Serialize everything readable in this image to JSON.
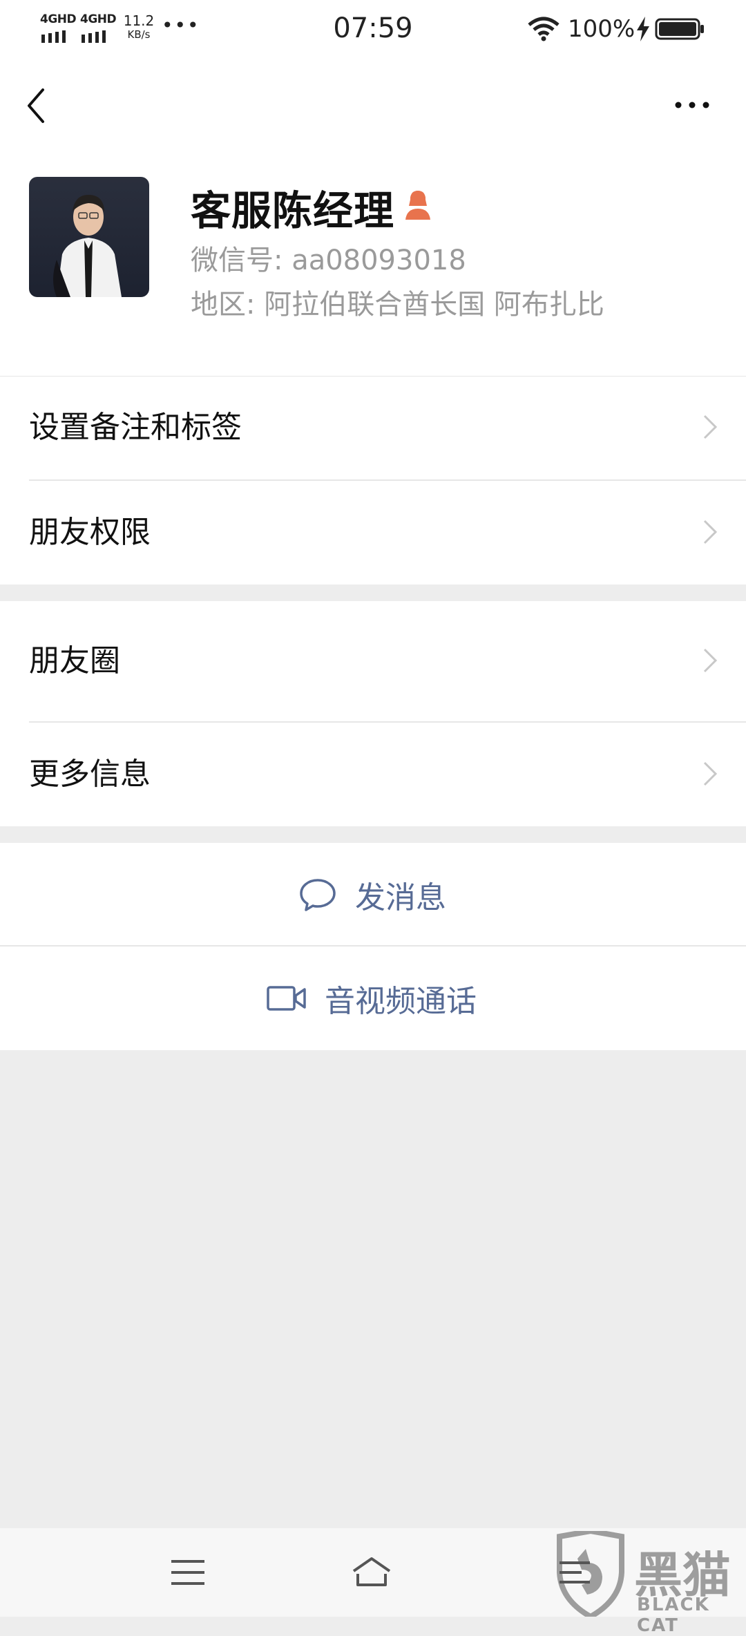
{
  "status_bar": {
    "signal1": "4GHD",
    "signal2": "4GHD",
    "speed_value": "11.2",
    "speed_unit": "KB/s",
    "more": "•••",
    "time": "07:59",
    "battery_percent": "100%"
  },
  "profile": {
    "name": "客服陈经理",
    "wechat_id": "微信号: aa08093018",
    "region": "地区: 阿拉伯联合酋长国  阿布扎比",
    "gender_icon": "female-user-icon",
    "accent_color": "#e8734d"
  },
  "menu_group_1": [
    {
      "label": "设置备注和标签"
    },
    {
      "label": "朋友权限"
    }
  ],
  "menu_group_2": [
    {
      "label": "朋友圈"
    },
    {
      "label": "更多信息"
    }
  ],
  "actions": {
    "send_message": "发消息",
    "video_call": "音视频通话",
    "link_color": "#576b95"
  },
  "watermark": {
    "title": "黑猫",
    "subtitle": "BLACK CAT"
  }
}
